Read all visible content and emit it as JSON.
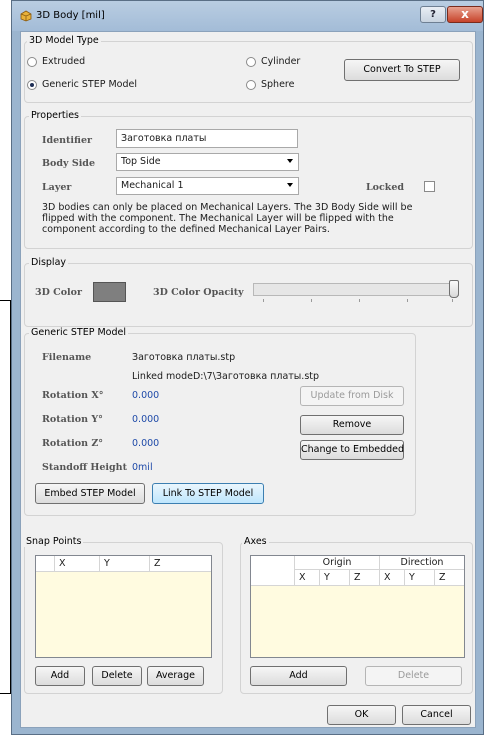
{
  "window": {
    "title": "3D Body [mil]",
    "help_glyph": "?",
    "close_glyph": "x"
  },
  "model_type": {
    "legend": "3D Model Type",
    "options": [
      {
        "label": "Extruded",
        "selected": false
      },
      {
        "label": "Generic STEP Model",
        "selected": true
      },
      {
        "label": "Cylinder",
        "selected": false
      },
      {
        "label": "Sphere",
        "selected": false
      }
    ],
    "convert_button": "Convert To STEP"
  },
  "properties": {
    "legend": "Properties",
    "identifier_label": "Identifier",
    "identifier_value": "Заготовка платы",
    "body_side_label": "Body Side",
    "body_side_value": "Top Side",
    "layer_label": "Layer",
    "layer_value": "Mechanical 1",
    "locked_label": "Locked",
    "locked_checked": false,
    "notice_line1": "3D bodies can only be placed on Mechanical Layers. The 3D Body Side will be",
    "notice_line2": "flipped with the component. The Mechanical Layer will be flipped with the",
    "notice_line3": "component according to the defined Mechanical Layer Pairs."
  },
  "display": {
    "legend": "Display",
    "color_label": "3D Color",
    "color_value": "#7f7f7f",
    "opacity_label": "3D Color Opacity",
    "opacity_level": 1.0
  },
  "step_model": {
    "legend": "Generic STEP Model",
    "filename_label": "Filename",
    "filename_value": "Заготовка платы.stp",
    "linked_prefix": "Linked mode",
    "linked_path": "D:\\7\\Заготовка платы.stp",
    "rot_x_label": "Rotation X°",
    "rot_x_value": "0.000",
    "rot_y_label": "Rotation Y°",
    "rot_y_value": "0.000",
    "rot_z_label": "Rotation Z°",
    "rot_z_value": "0.000",
    "standoff_label": "Standoff Height",
    "standoff_value": "0mil",
    "update_button": "Update from Disk",
    "remove_button": "Remove",
    "change_button": "Change to Embedded",
    "embed_button": "Embed STEP Model",
    "link_button": "Link To STEP Model"
  },
  "snap_points": {
    "legend": "Snap Points",
    "columns": [
      "X",
      "Y",
      "Z"
    ],
    "add_button": "Add",
    "delete_button": "Delete",
    "average_button": "Average"
  },
  "axes": {
    "legend": "Axes",
    "origin_header": "Origin",
    "direction_header": "Direction",
    "columns": [
      "X",
      "Y",
      "Z",
      "X",
      "Y",
      "Z"
    ],
    "add_button": "Add",
    "delete_button": "Delete"
  },
  "footer": {
    "ok_button": "OK",
    "cancel_button": "Cancel"
  }
}
